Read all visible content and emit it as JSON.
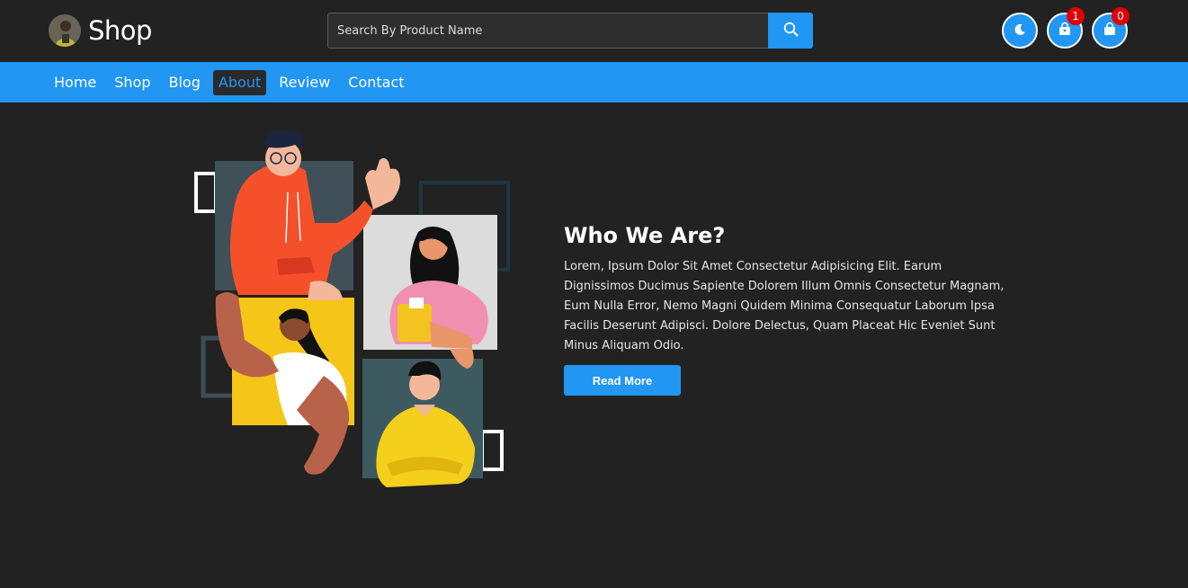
{
  "header": {
    "brand_name": "Shop",
    "search_placeholder": "Search By Product Name",
    "search_value": "",
    "icons": {
      "search": "search-icon",
      "theme": "moon-icon",
      "wishlist": "lock-bag-icon",
      "cart": "shopping-bag-icon"
    },
    "wishlist_count": "1",
    "cart_count": "0"
  },
  "nav": {
    "items": [
      {
        "label": "Home",
        "active": false
      },
      {
        "label": "Shop",
        "active": false
      },
      {
        "label": "Blog",
        "active": false
      },
      {
        "label": "About",
        "active": true
      },
      {
        "label": "Review",
        "active": false
      },
      {
        "label": "Contact",
        "active": false
      }
    ]
  },
  "about": {
    "title": "Who We Are?",
    "text": "Lorem, Ipsum Dolor Sit Amet Consectetur Adipisicing Elit. Earum Dignissimos Ducimus Sapiente Dolorem Illum Omnis Consectetur Magnam, Eum Nulla Error, Nemo Magni Quidem Minima Consequatur Laborum Ipsa Facilis Deserunt Adipisci. Dolore Delectus, Quam Placeat Hic Eveniet Sunt Minus Aliquam Odio.",
    "button_label": "Read More"
  },
  "colors": {
    "background": "#222222",
    "accent": "#2196f3",
    "badge": "#e00000"
  }
}
